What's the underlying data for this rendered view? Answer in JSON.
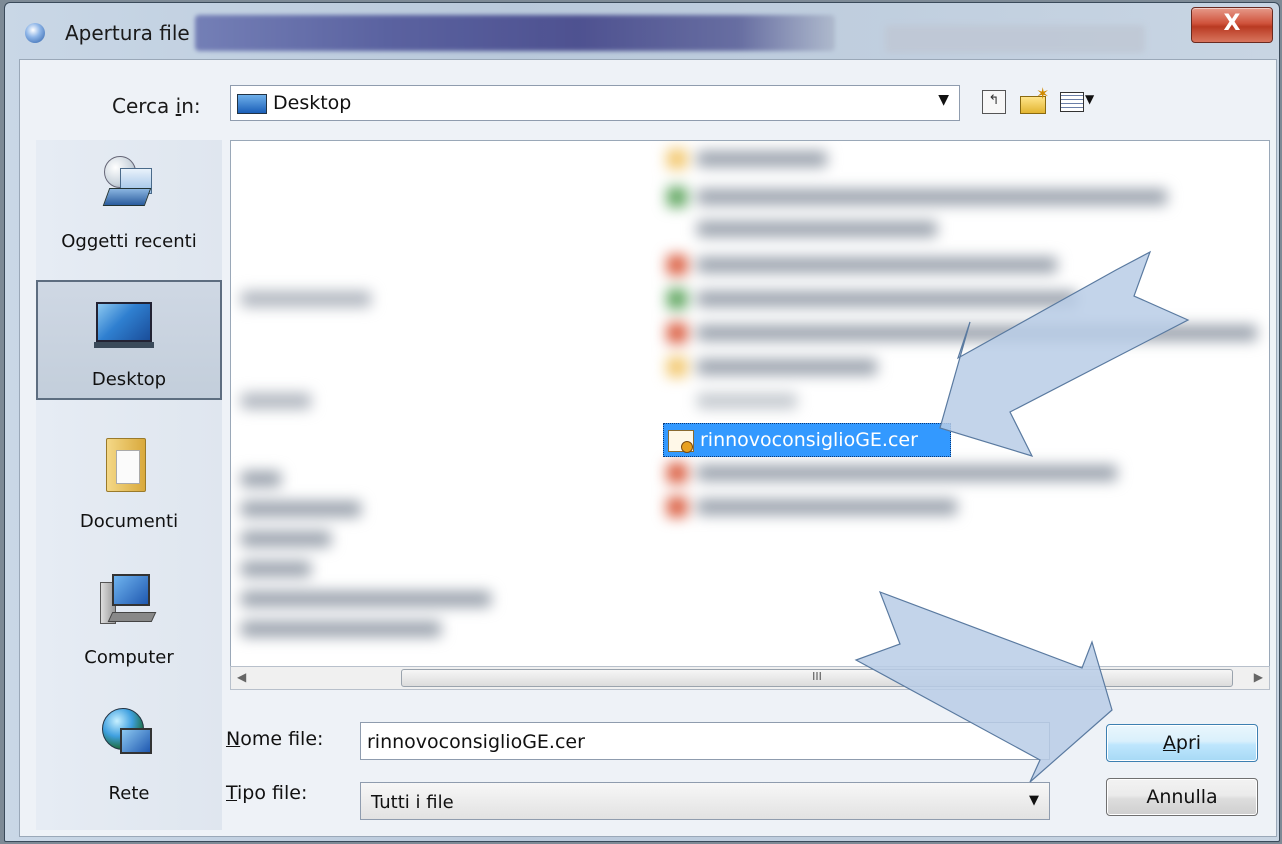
{
  "window": {
    "title": "Apertura file",
    "close_glyph": "X"
  },
  "toolbar": {
    "look_in_label_pre": "Cerca ",
    "look_in_label_key": "i",
    "look_in_label_post": "n:",
    "look_in_value": "Desktop",
    "up_icon": "folder-up-icon",
    "new_folder_icon": "new-folder-icon",
    "views_icon": "views-menu-icon"
  },
  "places": [
    {
      "label": "Oggetti recenti",
      "icon": "recent-items-icon"
    },
    {
      "label": "Desktop",
      "icon": "desktop-icon",
      "selected": true
    },
    {
      "label": "Documenti",
      "icon": "documents-icon"
    },
    {
      "label": "Computer",
      "icon": "computer-icon"
    },
    {
      "label": "Rete",
      "icon": "network-icon"
    }
  ],
  "file_list": {
    "selected_file": "rinnovoconsiglioGE.cer",
    "scrollbar_grip": "III"
  },
  "form": {
    "filename_label_key": "N",
    "filename_label_rest": "ome file:",
    "filename_value": "rinnovoconsiglioGE.cer",
    "filetype_label_key": "T",
    "filetype_label_rest": "ipo file:",
    "filetype_value": "Tutti i file"
  },
  "buttons": {
    "open_key": "A",
    "open_rest": "pri",
    "cancel": "Annulla"
  },
  "colors": {
    "selection": "#3399ff",
    "arrow_fill": "#b8cde6",
    "arrow_stroke": "#5a7aa0"
  }
}
